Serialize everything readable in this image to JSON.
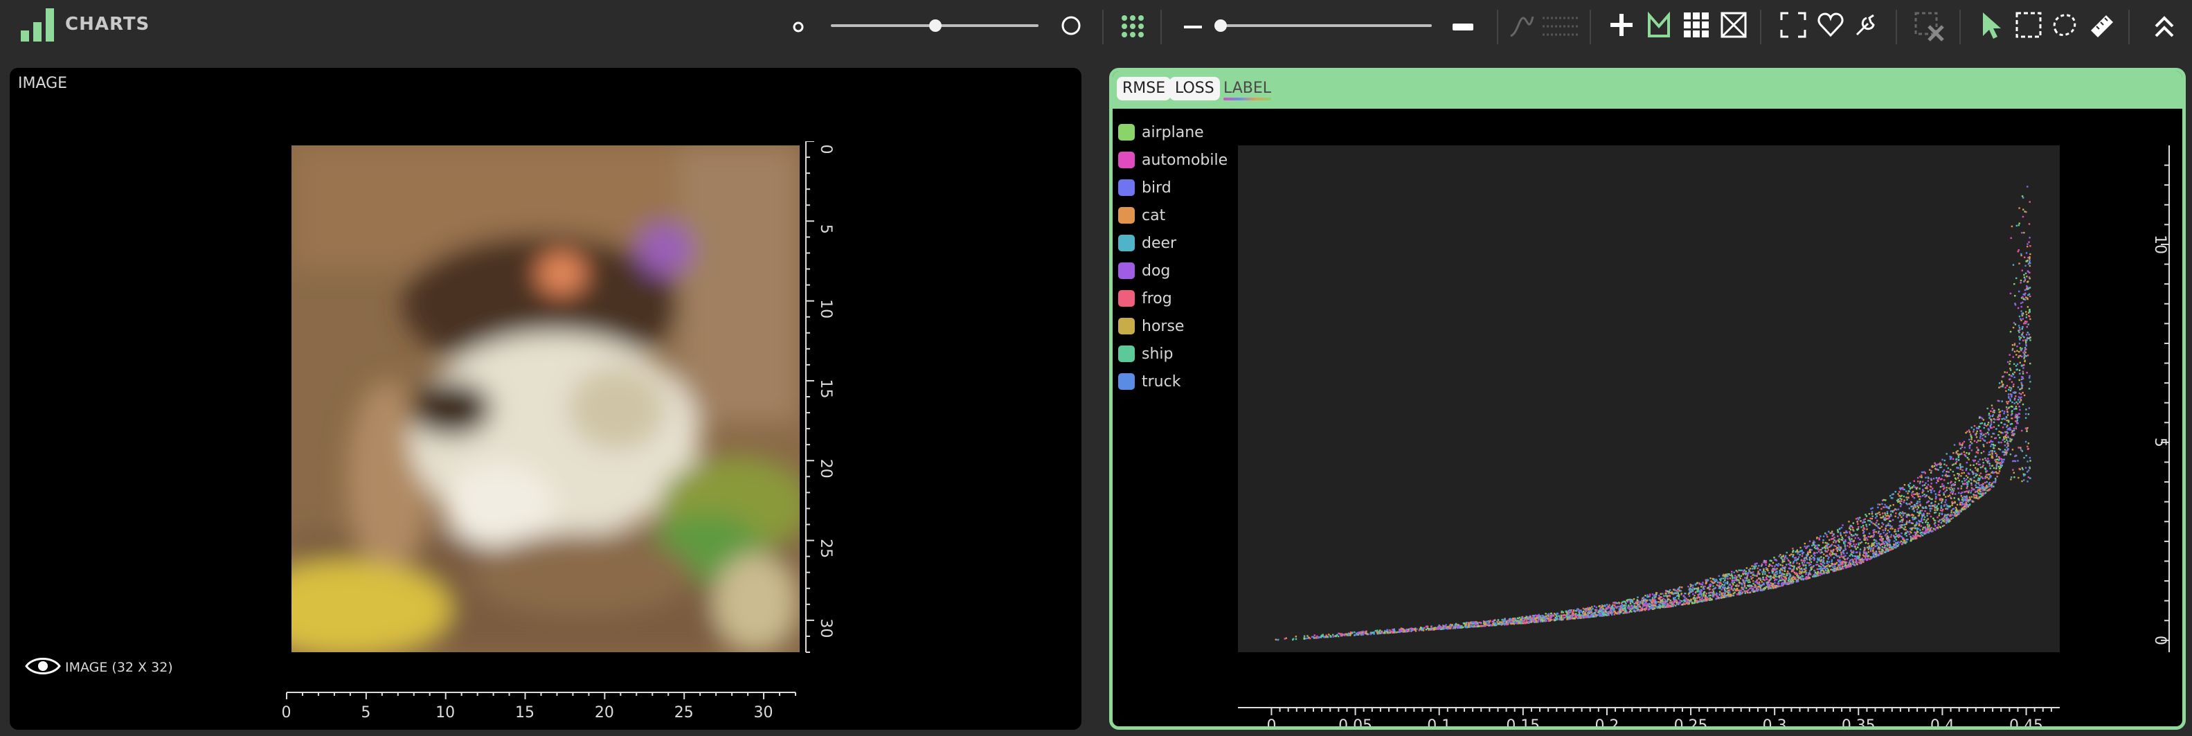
{
  "app": {
    "title": "CHARTS"
  },
  "colors": {
    "background": "#2b2b2b",
    "accent": "#8fd99a",
    "panel": "#000000",
    "plot_bg": "#222222"
  },
  "toolbar": {
    "icons": [
      "logo-bars-icon",
      "small-dot-icon",
      "large-ring-icon",
      "dot-grid-icon",
      "minus-icon",
      "large-minus-icon",
      "curve-icon",
      "dotted-grid-icon",
      "plus-icon",
      "selection-chart-icon",
      "grid-icon",
      "box-x-icon",
      "expand-icon",
      "heart-icon",
      "wrench-icon",
      "clear-selection-icon",
      "pointer-icon",
      "rect-select-icon",
      "lasso-icon",
      "ruler-icon",
      "collapse-icon"
    ],
    "point_size_slider": 0.5,
    "opacity_slider": 0.1
  },
  "image_panel": {
    "title": "IMAGE",
    "footer": "IMAGE (32 X 32)",
    "x_ticks": [
      "0",
      "5",
      "10",
      "15",
      "20",
      "25",
      "30"
    ],
    "y_ticks": [
      "0",
      "5",
      "10",
      "15",
      "20",
      "25",
      "30"
    ]
  },
  "chart_panel": {
    "tabs": [
      "RMSE",
      "LOSS"
    ],
    "active_label": "LABEL"
  },
  "chart_data": {
    "type": "scatter",
    "title": "",
    "xlabel": "",
    "ylabel": "",
    "xlim": [
      -0.02,
      0.47
    ],
    "ylim": [
      -0.3,
      12.5
    ],
    "x_ticks": [
      "0",
      "0.05",
      "0.1",
      "0.15",
      "0.2",
      "0.25",
      "0.3",
      "0.35",
      "0.4",
      "0.45"
    ],
    "y_ticks": [
      "0",
      "5",
      "10"
    ],
    "legend_position": "left",
    "series": [
      {
        "name": "airplane",
        "color": "#8bd46a"
      },
      {
        "name": "automobile",
        "color": "#e04cc0"
      },
      {
        "name": "bird",
        "color": "#6f74f0"
      },
      {
        "name": "cat",
        "color": "#e2944c"
      },
      {
        "name": "deer",
        "color": "#4fb4c8"
      },
      {
        "name": "dog",
        "color": "#a15ce6"
      },
      {
        "name": "frog",
        "color": "#ef5e7a"
      },
      {
        "name": "horse",
        "color": "#c8ac48"
      },
      {
        "name": "ship",
        "color": "#5cc99a"
      },
      {
        "name": "truck",
        "color": "#5a8ce6"
      }
    ],
    "curve": [
      [
        0.0,
        0.0
      ],
      [
        0.05,
        0.15
      ],
      [
        0.1,
        0.3
      ],
      [
        0.15,
        0.45
      ],
      [
        0.2,
        0.65
      ],
      [
        0.25,
        0.95
      ],
      [
        0.3,
        1.35
      ],
      [
        0.35,
        1.95
      ],
      [
        0.4,
        2.9
      ],
      [
        0.43,
        3.9
      ],
      [
        0.445,
        5.5
      ],
      [
        0.45,
        7.6
      ]
    ]
  }
}
